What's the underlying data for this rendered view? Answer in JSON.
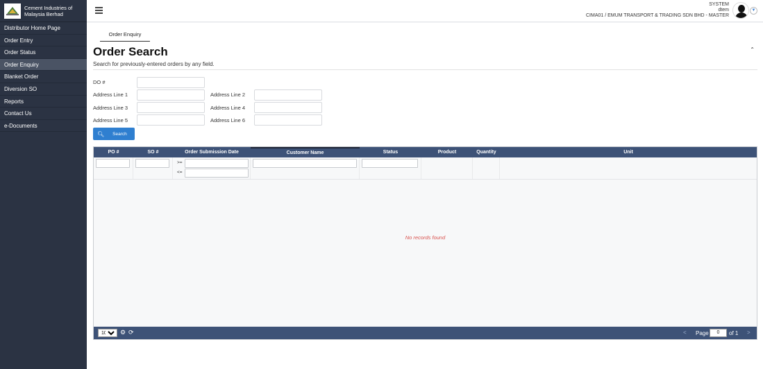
{
  "brand": {
    "name_line1": "Cement Industries of",
    "name_line2": "Malaysia Berhad"
  },
  "sidebar": {
    "items": [
      {
        "label": "Distributor Home Page"
      },
      {
        "label": "Order Entry"
      },
      {
        "label": "Order Status"
      },
      {
        "label": "Order Enquiry",
        "active": true
      },
      {
        "label": "Blanket Order"
      },
      {
        "label": "Diversion SO"
      },
      {
        "label": "Reports"
      },
      {
        "label": "Contact Us"
      },
      {
        "label": "e-Documents"
      }
    ]
  },
  "header": {
    "user_role": "SYSTEM",
    "user_name": "dtem",
    "company": "CIMA01 / EMUM TRANSPORT & TRADING SDN BHD - MASTER"
  },
  "main": {
    "tab_label": "Order Enquiry",
    "title": "Order Search",
    "subtitle": "Search for previously-entered orders by any field.",
    "form": {
      "do_label": "DO #",
      "addr1_label": "Address Line 1",
      "addr2_label": "Address Line 2",
      "addr3_label": "Address Line 3",
      "addr4_label": "Address Line 4",
      "addr5_label": "Address Line 5",
      "addr6_label": "Address Line 6",
      "search_label": "Search"
    }
  },
  "grid": {
    "columns": [
      "PO #",
      "SO #",
      "Order Submission Date",
      "Customer Name",
      "Status",
      "Product",
      "Quantity",
      "Unit"
    ],
    "date_ops": [
      ">=",
      "<="
    ],
    "empty_message": "No records found",
    "pager": {
      "page_size": "10",
      "page_label": "Page",
      "page_value": "0",
      "of_label": "of 1",
      "prev": "<",
      "next": ">"
    }
  },
  "colors": {
    "sidebar": "#2b3343",
    "grid_header": "#3d5277",
    "accent": "#2f7fd0",
    "empty_message": "#d9534f"
  }
}
